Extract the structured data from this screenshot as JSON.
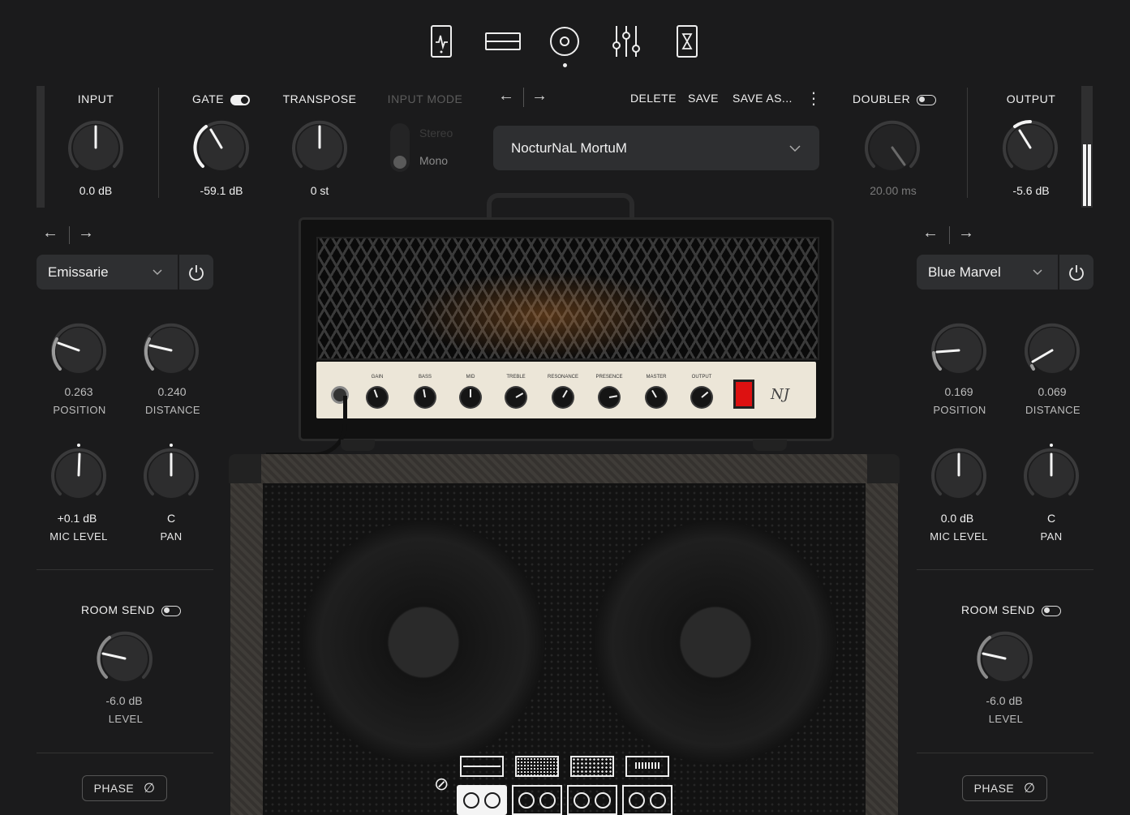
{
  "top_nav": {
    "icons": [
      "pedal-icon",
      "stompbox-icon",
      "amp-speaker-icon",
      "mixer-sliders-icon",
      "hourglass-icon"
    ],
    "active_index": 2
  },
  "input": {
    "label": "INPUT",
    "value": "0.0 dB"
  },
  "gate": {
    "label": "GATE",
    "value": "-59.1 dB",
    "enabled": true
  },
  "transpose": {
    "label": "TRANSPOSE",
    "value": "0 st"
  },
  "input_mode": {
    "label": "INPUT MODE",
    "options": [
      "Stereo",
      "Mono"
    ],
    "selected": "Mono"
  },
  "preset": {
    "name": "NocturNaL MortuM",
    "nav_prev": "←",
    "nav_next": "→",
    "delete_label": "DELETE",
    "save_label": "SAVE",
    "save_as_label": "SAVE AS...",
    "more": "⋮"
  },
  "doubler": {
    "label": "DOUBLER",
    "value": "20.00 ms",
    "enabled": false
  },
  "output": {
    "label": "OUTPUT",
    "value": "-5.6 dB"
  },
  "left_mic": {
    "nav_prev": "←",
    "nav_next": "→",
    "name": "Emissarie",
    "position": {
      "value": "0.263",
      "label": "POSITION"
    },
    "distance": {
      "value": "0.240",
      "label": "DISTANCE"
    },
    "mic_level": {
      "value": "+0.1 dB",
      "label": "MIC LEVEL"
    },
    "pan": {
      "value": "C",
      "label": "PAN"
    },
    "room_send": {
      "label": "ROOM SEND",
      "value": "-6.0 dB",
      "sub": "LEVEL",
      "enabled": false
    },
    "phase_label": "PHASE",
    "phase_symbol": "∅"
  },
  "right_mic": {
    "nav_prev": "←",
    "nav_next": "→",
    "name": "Blue Marvel",
    "position": {
      "value": "0.169",
      "label": "POSITION"
    },
    "distance": {
      "value": "0.069",
      "label": "DISTANCE"
    },
    "mic_level": {
      "value": "0.0 dB",
      "label": "MIC LEVEL"
    },
    "pan": {
      "value": "C",
      "label": "PAN"
    },
    "room_send": {
      "label": "ROOM SEND",
      "value": "-6.0 dB",
      "sub": "LEVEL",
      "enabled": false
    },
    "phase_label": "PHASE",
    "phase_symbol": "∅"
  },
  "amp_controls": [
    "GAIN",
    "BASS",
    "MID",
    "TREBLE",
    "RESONANCE",
    "PRESENCE",
    "MASTER",
    "OUTPUT"
  ],
  "amp_signature": "NJ",
  "cab_selector": {
    "selected_index": 0
  },
  "colors": {
    "background": "#1b1b1c",
    "panel": "#2e2f31",
    "accent": "#f0f0f0",
    "amp_face": "#ece6d8",
    "power_switch": "#d11"
  }
}
